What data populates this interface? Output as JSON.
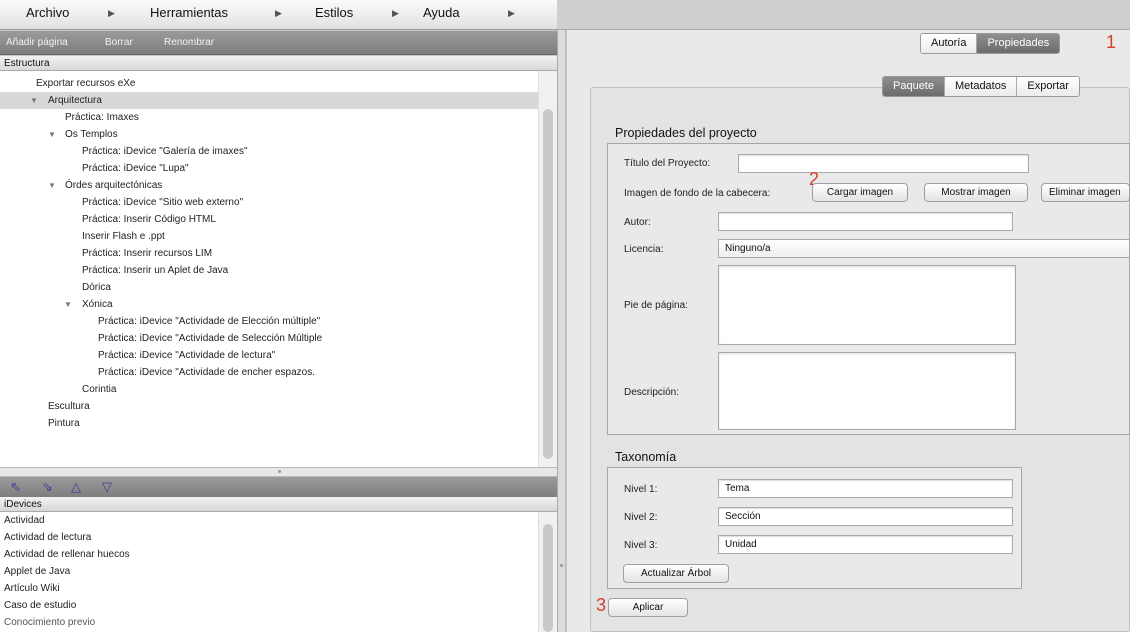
{
  "menu": {
    "items": [
      "Archivo",
      "Herramientas",
      "Estilos",
      "Ayuda"
    ]
  },
  "outline_toolbar": {
    "add_page": "Añadir página",
    "delete": "Borrar",
    "rename": "Renombrar"
  },
  "structure": {
    "header": "Estructura",
    "nodes": [
      {
        "label": "Exportar recursos eXe",
        "toggle": ""
      },
      {
        "label": "Arquitectura",
        "toggle": "▼"
      },
      {
        "label": "Práctica: Imaxes",
        "toggle": ""
      },
      {
        "label": "Os Templos",
        "toggle": "▼"
      },
      {
        "label": "Práctica: iDevice \"Galería de imaxes\"",
        "toggle": ""
      },
      {
        "label": "Práctica: iDevice \"Lupa\"",
        "toggle": ""
      },
      {
        "label": "Órdes arquitectónicas",
        "toggle": "▼"
      },
      {
        "label": "Práctica: iDevice \"Sitio web externo\"",
        "toggle": ""
      },
      {
        "label": "Práctica: Inserir Código HTML",
        "toggle": ""
      },
      {
        "label": "Inserir Flash e .ppt",
        "toggle": ""
      },
      {
        "label": "Práctica: Inserir recursos LIM",
        "toggle": ""
      },
      {
        "label": "Práctica: Inserir un Aplet de Java",
        "toggle": ""
      },
      {
        "label": "Dórica",
        "toggle": ""
      },
      {
        "label": "Xónica",
        "toggle": "▼"
      },
      {
        "label": "Práctica: iDevice \"Actividade de Elección múltiple\"",
        "toggle": ""
      },
      {
        "label": "Práctica: iDevice \"Actividade de Selección Múltiple",
        "toggle": ""
      },
      {
        "label": "Práctica: iDevice \"Actividade de lectura\"",
        "toggle": ""
      },
      {
        "label": "Práctica: iDevice \"Actividade de encher espazos.",
        "toggle": ""
      },
      {
        "label": "Corintia",
        "toggle": ""
      },
      {
        "label": "Escultura",
        "toggle": ""
      },
      {
        "label": "Pintura",
        "toggle": ""
      }
    ]
  },
  "move_arrows": {
    "promote": "⇖",
    "demote": "⇘",
    "up": "△",
    "down": "▽"
  },
  "idevices": {
    "header": "iDevices",
    "items": [
      "Actividad",
      "Actividad de lectura",
      "Actividad de rellenar huecos",
      "Applet de Java",
      "Artículo Wiki",
      "Caso de estudio",
      "Conocimiento previo"
    ]
  },
  "top_tabs": {
    "authoring": "Autoría",
    "properties": "Propiedades",
    "marker": "1"
  },
  "sub_tabs": {
    "package": "Paquete",
    "metadata": "Metadatos",
    "export": "Exportar"
  },
  "project": {
    "section_title": "Propiedades del proyecto",
    "title_label": "Título del Proyecto:",
    "title_value": "",
    "header_image_label": "Imagen de fondo de la cabecera:",
    "marker": "2",
    "load_image": "Cargar imagen",
    "show_image": "Mostrar imagen",
    "remove_image": "Eliminar imagen",
    "author_label": "Autor:",
    "author_value": "",
    "license_label": "Licencia:",
    "license_value": "Ninguno/a",
    "footer_label": "Pie de página:",
    "description_label": "Descripción:"
  },
  "taxonomy": {
    "section_title": "Taxonomía",
    "level1_label": "Nivel 1:",
    "level1_value": "Tema",
    "level2_label": "Nivel 2:",
    "level2_value": "Sección",
    "level3_label": "Nivel 3:",
    "level3_value": "Unidad",
    "update_tree": "Actualizar Árbol"
  },
  "apply": {
    "marker": "3",
    "label": "Aplicar"
  },
  "colors": {
    "marker_red": "#d6402c",
    "active_tab": "#7a7a7a"
  }
}
